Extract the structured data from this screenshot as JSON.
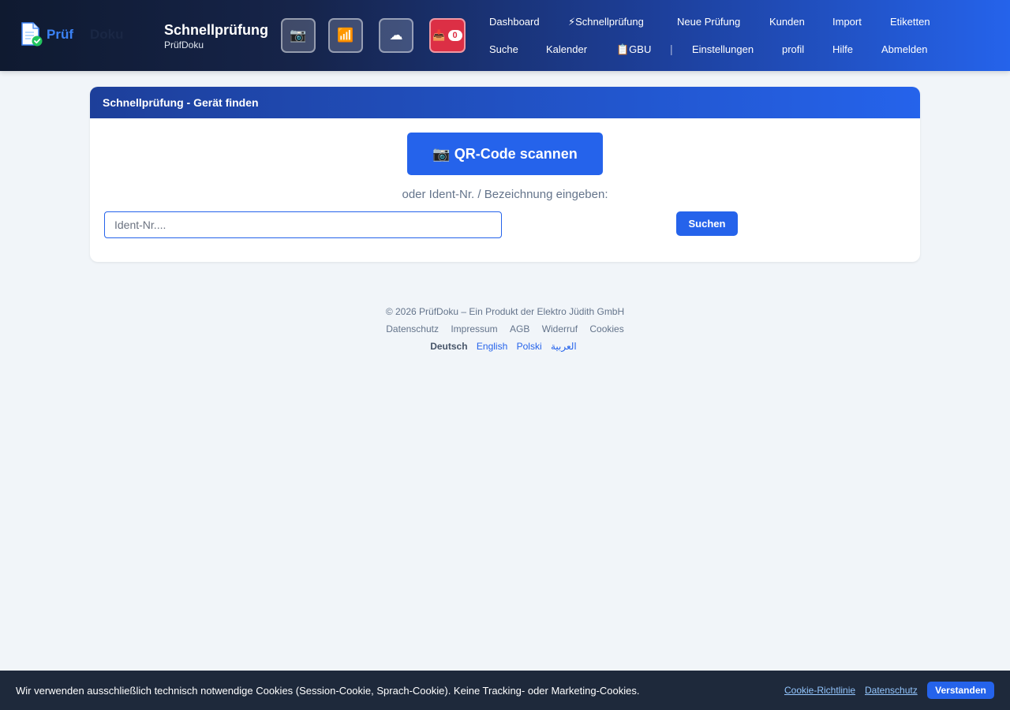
{
  "header": {
    "logo": {
      "part1": "Prüf",
      "part2": "Doku"
    },
    "title": "Schnellprüfung",
    "subtitle": "PrüfDoku",
    "buttons": {
      "camera": "📷",
      "signal": "📶",
      "cloud": "☁",
      "inbox": "📥",
      "inbox_count": "0"
    },
    "nav_row1": [
      "Dashboard",
      "⚡Schnellprüfung",
      "Neue Prüfung",
      "Kunden",
      "Import",
      "Etiketten"
    ],
    "nav_row2": [
      "Suche",
      "Kalender",
      "📋GBU",
      "|",
      "Einstellungen",
      "profil",
      "Hilfe",
      "Abmelden"
    ]
  },
  "card": {
    "title": "Schnellprüfung - Gerät finden",
    "qr_button": "📷 QR-Code scannen",
    "or_text": "oder Ident-Nr. / Bezeichnung eingeben:",
    "input_placeholder": "Ident-Nr....",
    "search_button": "Suchen"
  },
  "footer": {
    "copyright": "© 2026 PrüfDoku – Ein Produkt der Elektro Jüdith GmbH",
    "links": [
      "Datenschutz",
      "Impressum",
      "AGB",
      "Widerruf",
      "Cookies"
    ],
    "current_language": "Deutsch",
    "languages": [
      "English",
      "Polski",
      "العربية"
    ]
  },
  "cookie_bar": {
    "text": "Wir verwenden ausschließlich technisch notwendige Cookies (Session-Cookie, Sprach-Cookie). Keine Tracking- oder Marketing-Cookies.",
    "policy_link": "Cookie-Richtlinie",
    "privacy_link": "Datenschutz",
    "accept_button": "Verstanden"
  },
  "colors": {
    "brand_blue": "#2563eb",
    "header_dark": "#0f1a30",
    "alert_red": "#dc2f45",
    "page_bg": "#f1f5f9",
    "cookie_bg": "#1e293b"
  }
}
